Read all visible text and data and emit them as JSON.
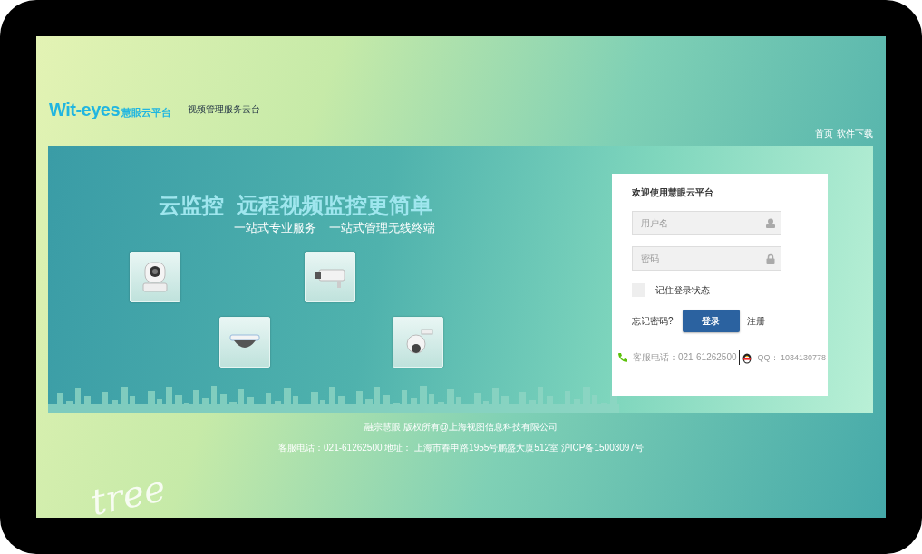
{
  "logo": {
    "brand": "Wit-eyes",
    "brand_cn": "慧眼云平台"
  },
  "tagline": "视频管理服务云台",
  "nav": [
    {
      "label": "首页"
    },
    {
      "label": "软件下载"
    }
  ],
  "banner": {
    "headline": [
      "云监控",
      "远程视频监控更简单"
    ],
    "subline": [
      "一站式专业服务",
      "一站式管理无线终端"
    ],
    "cameras": [
      {
        "kind": "ptz"
      },
      {
        "kind": "bullet"
      },
      {
        "kind": "dome"
      },
      {
        "kind": "speed-dome"
      }
    ]
  },
  "login": {
    "title": "欢迎使用慧眼云平台",
    "username_placeholder": "用户名",
    "password_placeholder": "密码",
    "remember": {
      "label": "记住登录状态",
      "checked": false
    },
    "forgot": "忘记密码?",
    "submit": "登录",
    "register": "注册",
    "service_phone": "客服电话：021-61262500",
    "qq": "QQ： 1034130778"
  },
  "footer": {
    "copyright": "融宗慧眼 版权所有@上海视图信息科技有限公司",
    "contact": "客服电话：021-61262500 地址： 上海市春申路1955号鹏盛大厦512室 沪ICP备15003097号"
  },
  "decoration_text": "tree"
}
